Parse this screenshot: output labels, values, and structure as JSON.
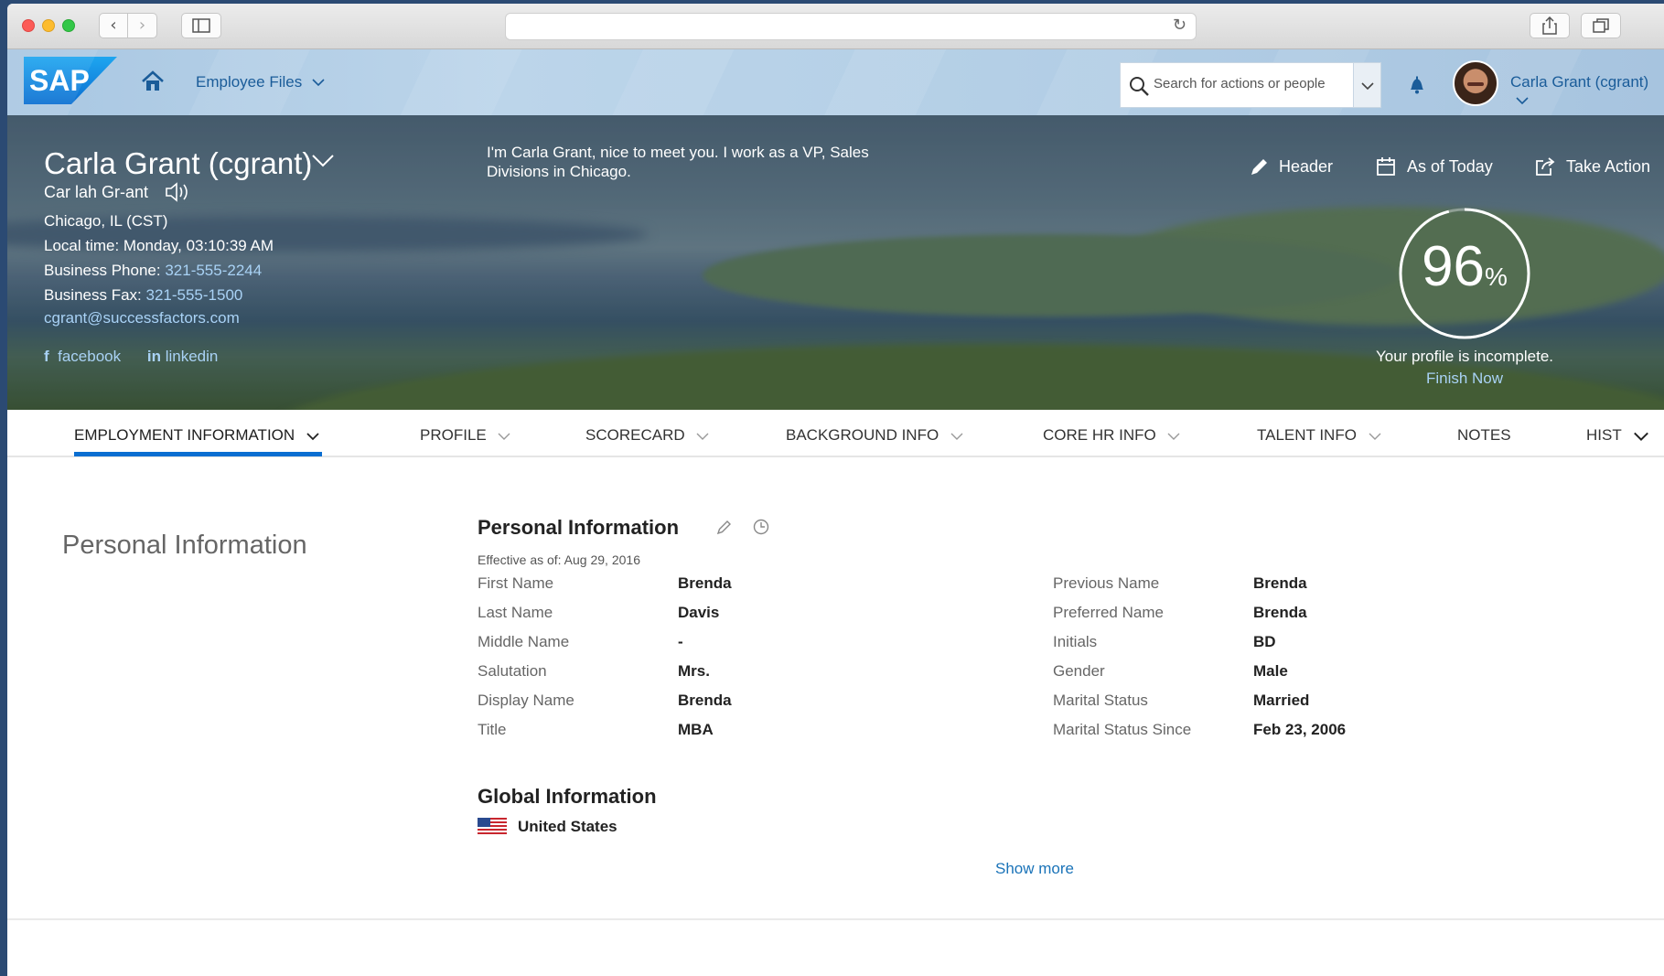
{
  "browser": {
    "back_glyph": "‹",
    "forward_glyph": "›",
    "reload_glyph": "↻"
  },
  "shell": {
    "nav_menu": "Employee Files",
    "search_placeholder": "Search for actions or people",
    "user_name": "Carla Grant (cgrant)"
  },
  "header": {
    "name": "Carla Grant (cgrant)",
    "phonetic": "Car lah Gr-ant",
    "location": "Chicago, IL (CST)",
    "local_time": "Local time: Monday, 03:10:39 AM",
    "business_phone_label": "Business Phone:",
    "business_phone": "321-555-2244",
    "business_fax_label": "Business Fax:",
    "business_fax": "321-555-1500",
    "email": "cgrant@successfactors.com",
    "social": {
      "facebook": "facebook",
      "linkedin": "linkedin",
      "facebook_glyph": "f",
      "linkedin_glyph": "in"
    },
    "bio": "I'm Carla Grant, nice to meet you. I work as a VP, Sales Divisions in Chicago.",
    "actions": {
      "header": "Header",
      "as_of_today": "As of Today",
      "take_action": "Take Action"
    },
    "profile_completion": {
      "percent": 96,
      "percent_sign": "%",
      "message": "Your profile is incomplete.",
      "link": "Finish Now"
    }
  },
  "tabs": [
    {
      "label": "EMPLOYMENT INFORMATION",
      "active": true
    },
    {
      "label": "PROFILE"
    },
    {
      "label": "SCORECARD"
    },
    {
      "label": "BACKGROUND INFO"
    },
    {
      "label": "CORE HR INFO"
    },
    {
      "label": "TALENT INFO"
    },
    {
      "label": "NOTES"
    },
    {
      "label": "HIST"
    }
  ],
  "content": {
    "section_title": "Personal Information",
    "card_title": "Personal Information",
    "effective": "Effective as of: Aug 29, 2016",
    "left_fields": [
      {
        "label": "First Name",
        "value": "Brenda"
      },
      {
        "label": "Last Name",
        "value": "Davis"
      },
      {
        "label": "Middle Name",
        "value": "-"
      },
      {
        "label": "Salutation",
        "value": "Mrs."
      },
      {
        "label": "Display Name",
        "value": "Brenda"
      },
      {
        "label": "Title",
        "value": "MBA"
      }
    ],
    "right_fields": [
      {
        "label": "Previous Name",
        "value": "Brenda"
      },
      {
        "label": "Preferred Name",
        "value": "Brenda"
      },
      {
        "label": "Initials",
        "value": "BD"
      },
      {
        "label": "Gender",
        "value": "Male"
      },
      {
        "label": "Marital Status",
        "value": "Married"
      },
      {
        "label": "Marital Status Since",
        "value": "Feb 23, 2006"
      }
    ],
    "global_title": "Global Information",
    "country": "United States",
    "show_more": "Show more"
  },
  "colors": {
    "brand_blue": "#0a6ed1",
    "link_blue": "#1a73b8",
    "header_link": "#a9d2f5",
    "shell_text": "#1a5c99"
  }
}
